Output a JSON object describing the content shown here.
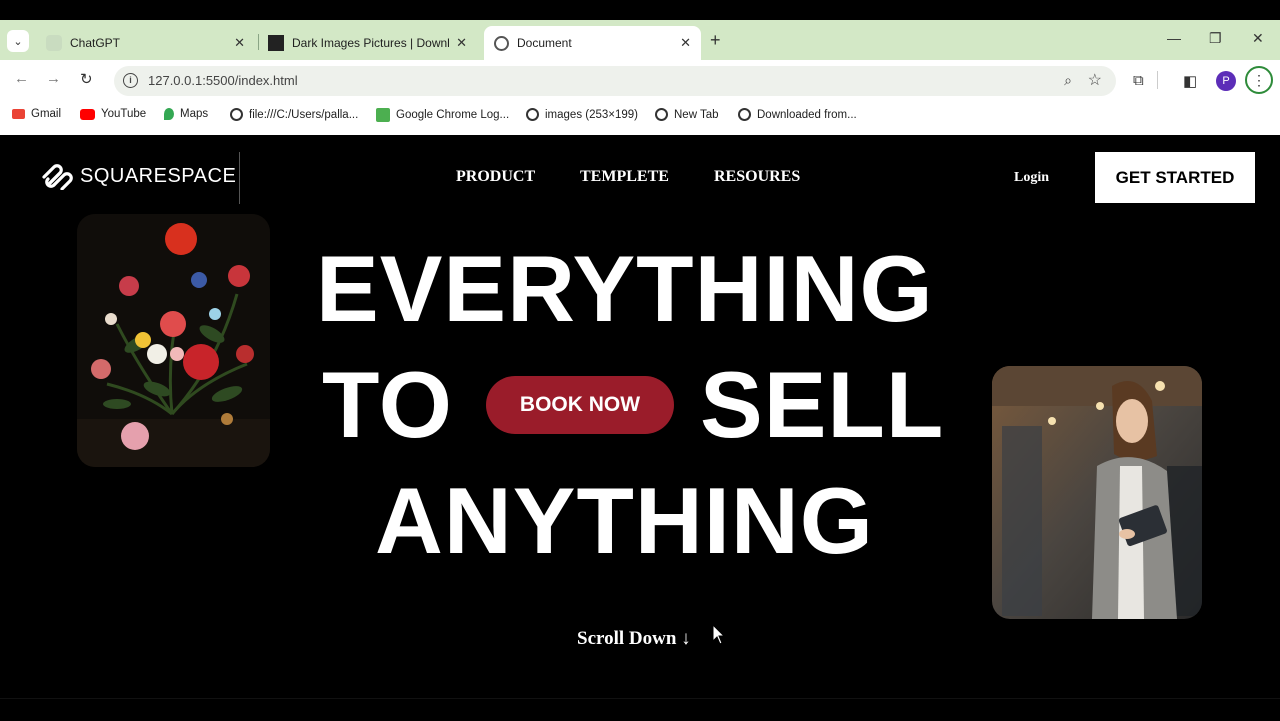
{
  "browser": {
    "tabs": [
      {
        "title": "ChatGPT",
        "active": false
      },
      {
        "title": "Dark Images Pictures | Downlo",
        "active": false
      },
      {
        "title": "Document",
        "active": true
      }
    ],
    "url": "127.0.0.1:5500/index.html",
    "profile_initial": "P",
    "bookmarks": [
      {
        "label": "Gmail"
      },
      {
        "label": "YouTube"
      },
      {
        "label": "Maps"
      },
      {
        "label": "file:///C:/Users/palla..."
      },
      {
        "label": "Google Chrome Log..."
      },
      {
        "label": "images (253×199)"
      },
      {
        "label": "New Tab"
      },
      {
        "label": "Downloaded from..."
      }
    ]
  },
  "site": {
    "logo_text": "SQUARESPACE",
    "nav": [
      "PRODUCT",
      "TEMPLETE",
      "RESOURES"
    ],
    "login": "Login",
    "cta": "GET STARTED",
    "headline": {
      "line1": "EVERYTHING",
      "line2a": "TO",
      "line2b": "SELL",
      "line3": "ANYTHING"
    },
    "book_now": "BOOK NOW",
    "scroll_down": "Scroll Down ↓"
  },
  "colors": {
    "accent": "#9a1c2a",
    "tabbar": "#d3e8c6",
    "background": "#000000"
  }
}
